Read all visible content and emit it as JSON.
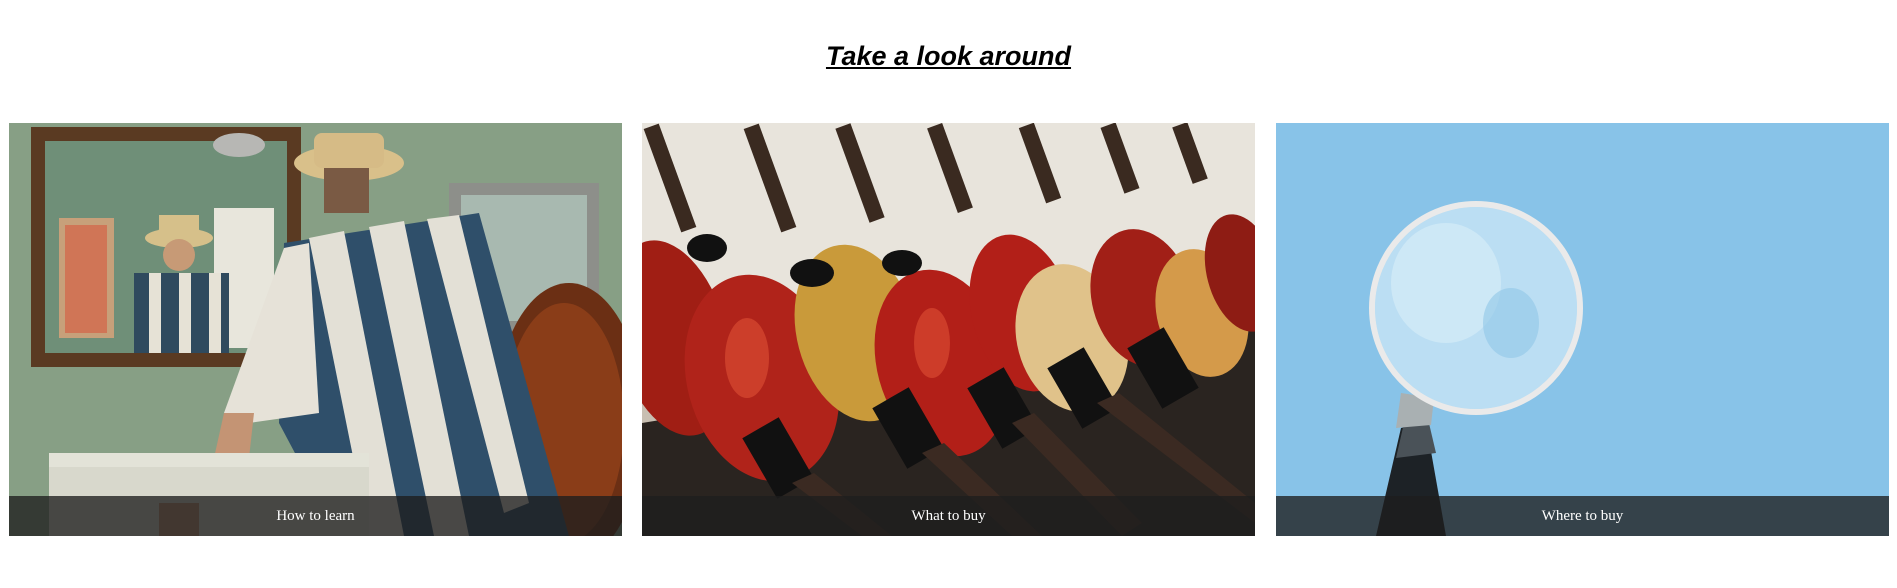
{
  "page": {
    "title": "Take a look around"
  },
  "cards": [
    {
      "caption": "How to learn",
      "image": "man-with-guitar-looking-in-mirror"
    },
    {
      "caption": "What to buy",
      "image": "guitars-hanging-on-wall"
    },
    {
      "caption": "Where to buy",
      "image": "magnifying-glass-on-blue"
    }
  ]
}
